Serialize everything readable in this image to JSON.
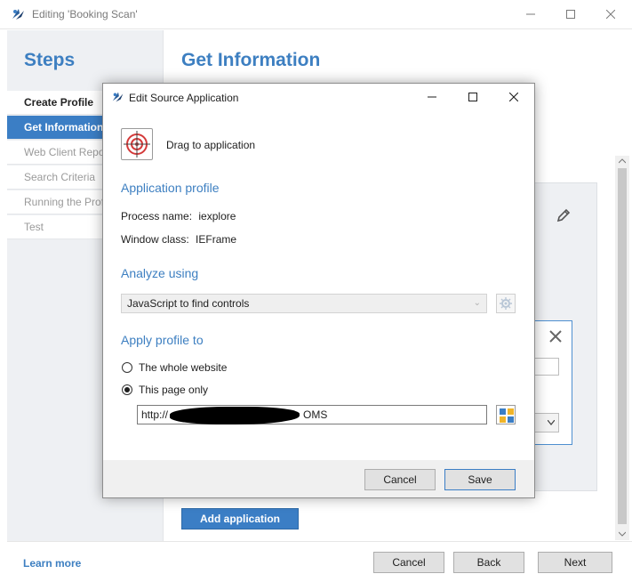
{
  "window": {
    "title": "Editing 'Booking Scan'",
    "minimize_icon": "minimize-icon",
    "maximize_icon": "maximize-icon",
    "close_icon": "close-icon"
  },
  "steps": {
    "title": "Steps",
    "items": [
      {
        "label": "Create Profile",
        "state": "done"
      },
      {
        "label": "Get Information",
        "state": "active"
      },
      {
        "label": "Web Client Reports",
        "state": "pending"
      },
      {
        "label": "Search Criteria",
        "state": "pending"
      },
      {
        "label": "Running the Profile",
        "state": "pending"
      },
      {
        "label": "Test",
        "state": "pending"
      }
    ]
  },
  "main": {
    "title": "Get Information",
    "add_application_label": "Add application"
  },
  "footer": {
    "learn_more": "Learn more",
    "cancel": "Cancel",
    "back": "Back",
    "next": "Next"
  },
  "dialog": {
    "title": "Edit Source Application",
    "drag_label": "Drag to application",
    "application_profile_heading": "Application profile",
    "process_name_label": "Process name:",
    "process_name_value": "iexplore",
    "window_class_label": "Window class:",
    "window_class_value": "IEFrame",
    "analyze_heading": "Analyze using",
    "analyze_selected": "JavaScript to find controls",
    "apply_heading": "Apply profile to",
    "option_whole_website": "The whole website",
    "option_this_page": "This page only",
    "selected_option": "this_page",
    "url_prefix": "http://",
    "url_suffix": "OMS",
    "cancel": "Cancel",
    "save": "Save"
  },
  "colors": {
    "accent": "#3b7ec5",
    "heading": "#3d7fc1",
    "panel": "#eef0f3"
  }
}
